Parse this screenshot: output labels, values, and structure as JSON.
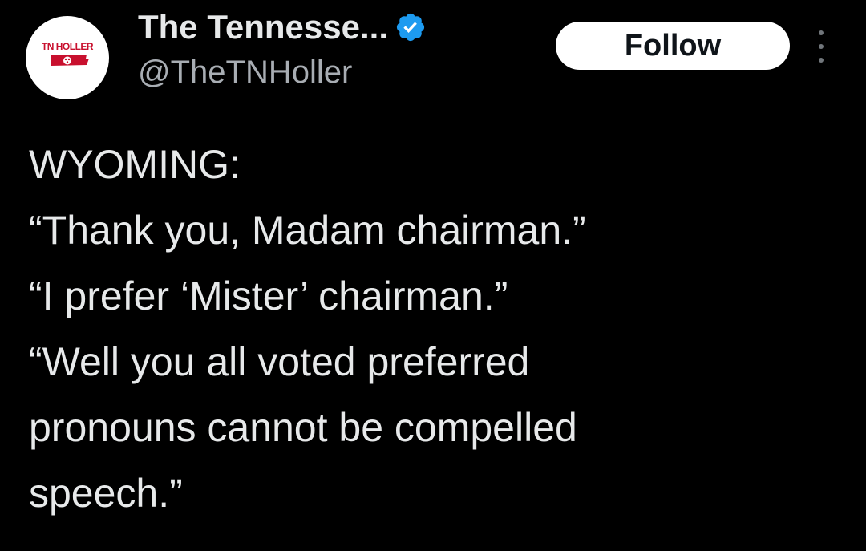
{
  "account": {
    "avatar_text": "TN HOLLER",
    "display_name": "The Tennesse...",
    "handle": "@TheTNHoller",
    "verified_color": "#1d9bf0"
  },
  "actions": {
    "follow_label": "Follow",
    "more_icon": "vertical-ellipsis-icon"
  },
  "tweet": {
    "lines": [
      "WYOMING:",
      "“Thank you, Madam chairman.”",
      "“I prefer ‘Mister’ chairman.”",
      "“Well you all voted preferred",
      "pronouns cannot be compelled",
      "speech.”"
    ]
  },
  "colors": {
    "background": "#000000",
    "text": "#e7e9ea",
    "handle": "#a8adb3",
    "follow_bg": "#ffffff",
    "avatar_red": "#c8102e"
  }
}
